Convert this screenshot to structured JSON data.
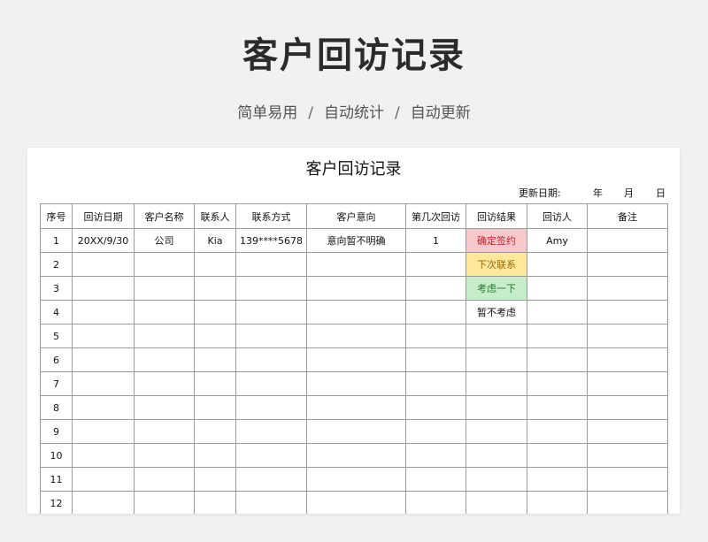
{
  "hero": {
    "title": "客户回访记录",
    "subtitle_parts": [
      "简单易用",
      "/",
      "自动统计",
      "/",
      "自动更新"
    ]
  },
  "sheet": {
    "title": "客户回访记录",
    "update_label": "更新日期:",
    "year_label": "年",
    "month_label": "月",
    "day_label": "日",
    "columns": [
      "序号",
      "回访日期",
      "客户名称",
      "联系人",
      "联系方式",
      "客户意向",
      "第几次回访",
      "回访结果",
      "回访人",
      "备注"
    ],
    "rows": [
      [
        "1",
        "20XX/9/30",
        "公司",
        "Kia",
        "139****5678",
        "意向暂不明确",
        "1",
        "确定签约",
        "Amy",
        ""
      ],
      [
        "2",
        "",
        "",
        "",
        "",
        "",
        "",
        "下次联系",
        "",
        ""
      ],
      [
        "3",
        "",
        "",
        "",
        "",
        "",
        "",
        "考虑一下",
        "",
        ""
      ],
      [
        "4",
        "",
        "",
        "",
        "",
        "",
        "",
        "暂不考虑",
        "",
        ""
      ],
      [
        "5",
        "",
        "",
        "",
        "",
        "",
        "",
        "",
        "",
        ""
      ],
      [
        "6",
        "",
        "",
        "",
        "",
        "",
        "",
        "",
        "",
        ""
      ],
      [
        "7",
        "",
        "",
        "",
        "",
        "",
        "",
        "",
        "",
        ""
      ],
      [
        "8",
        "",
        "",
        "",
        "",
        "",
        "",
        "",
        "",
        ""
      ],
      [
        "9",
        "",
        "",
        "",
        "",
        "",
        "",
        "",
        "",
        ""
      ],
      [
        "10",
        "",
        "",
        "",
        "",
        "",
        "",
        "",
        "",
        ""
      ],
      [
        "11",
        "",
        "",
        "",
        "",
        "",
        "",
        "",
        "",
        ""
      ],
      [
        "12",
        "",
        "",
        "",
        "",
        "",
        "",
        "",
        "",
        ""
      ]
    ],
    "result_styles": [
      {
        "bg": "#f8c9cc",
        "fg": "#c0242c"
      },
      {
        "bg": "#fde89c",
        "fg": "#9a6a00"
      },
      {
        "bg": "#c8edcb",
        "fg": "#1f7a2e"
      },
      {
        "bg": "#ffffff",
        "fg": "#111111"
      }
    ]
  }
}
